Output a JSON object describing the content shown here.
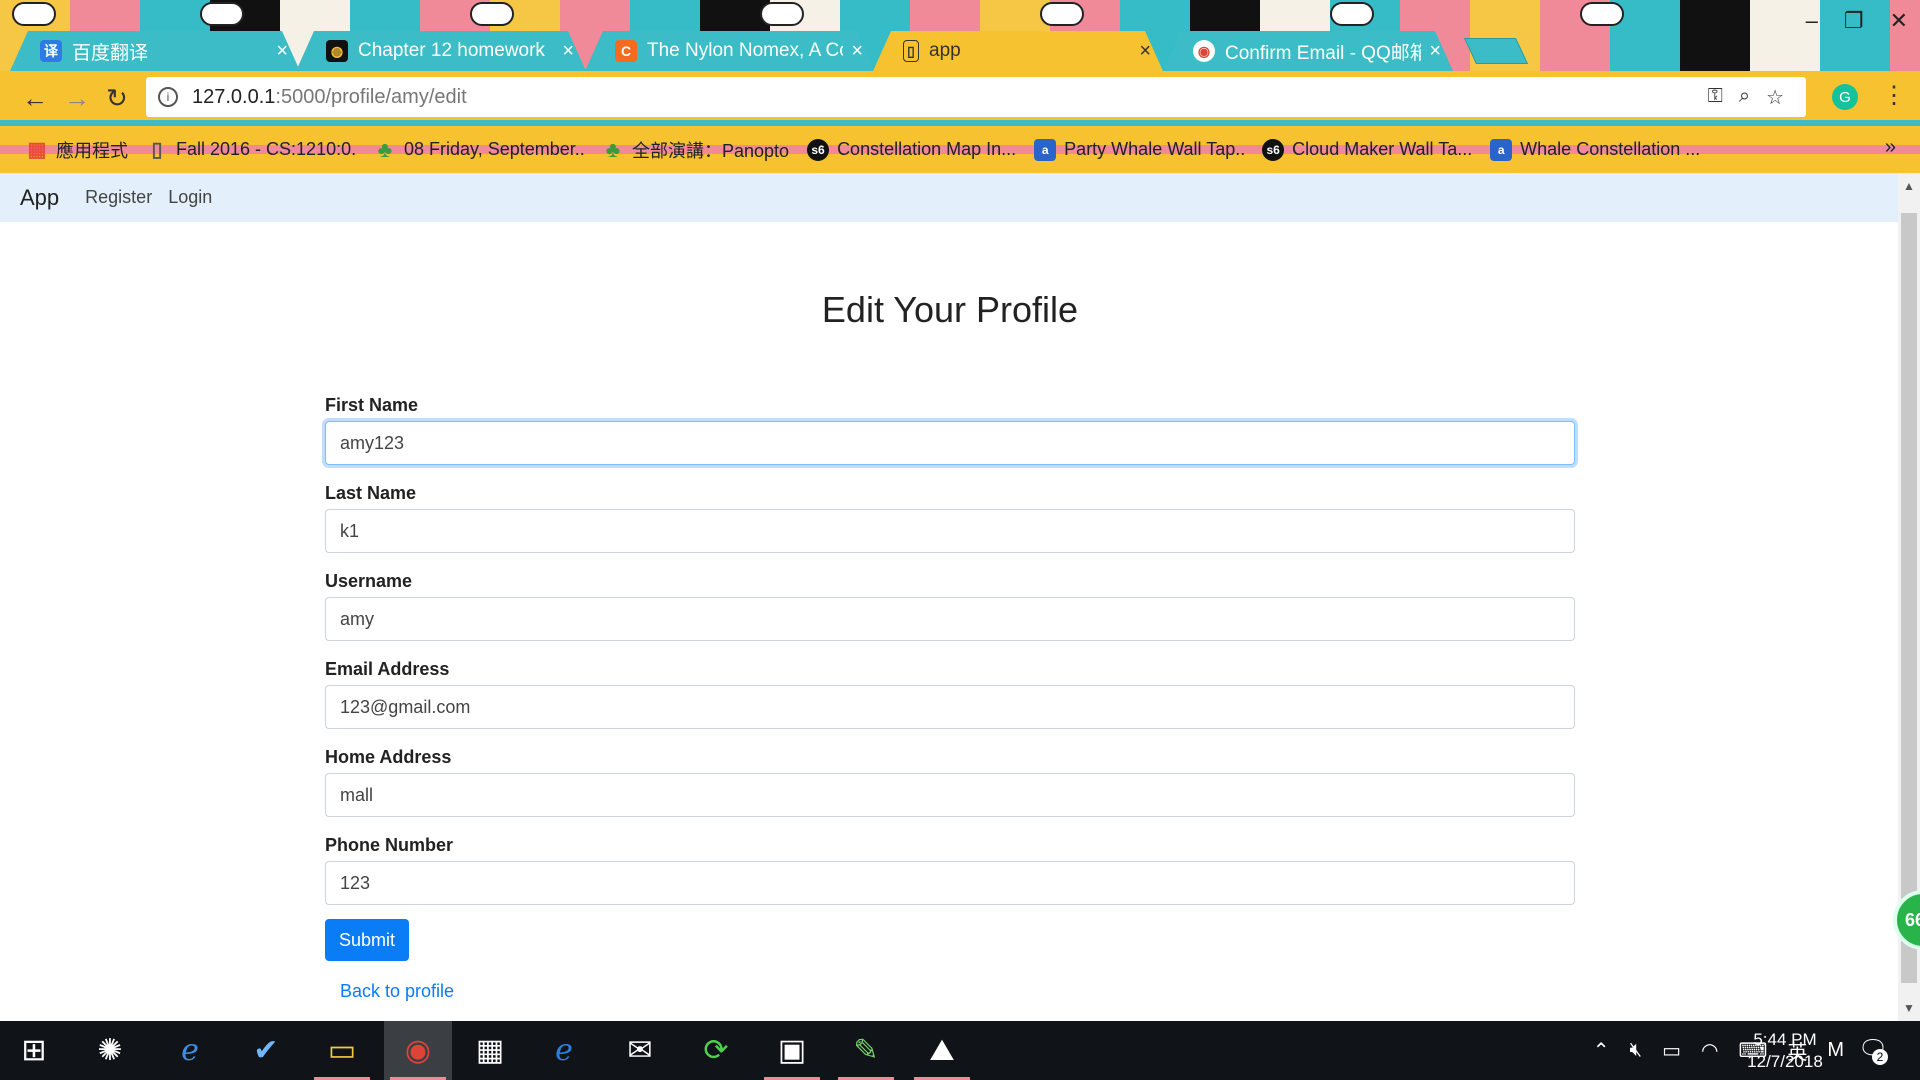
{
  "browser": {
    "tabs": [
      {
        "title": "百度翻译",
        "favicon_icon": "translate-icon",
        "favicon_glyph": "译",
        "favicon_color": "#2f7be5"
      },
      {
        "title": "Chapter 12 homework",
        "favicon_icon": "canvas-icon",
        "favicon_glyph": "◍",
        "favicon_color": "#111111"
      },
      {
        "title": "The Nylon Nomex, A Con",
        "favicon_icon": "c-logo-icon",
        "favicon_glyph": "C",
        "favicon_color": "#f26b21"
      },
      {
        "title": "app",
        "favicon_icon": "page-icon",
        "favicon_glyph": "▯",
        "favicon_color": "#f6c230",
        "active": true
      },
      {
        "title": "Confirm Email - QQ邮箱",
        "favicon_icon": "chrome-icon",
        "favicon_glyph": "◉",
        "favicon_color": "#db4437"
      }
    ],
    "tab_close_glyph": "×",
    "address": {
      "host": "127.0.0.1",
      "path": ":5000/profile/amy/edit"
    },
    "bookmarks": [
      {
        "label": "應用程式",
        "icon": "apps-grid-icon",
        "glyph": "▦",
        "color": "#e74c3c"
      },
      {
        "label": "Fall 2016 - CS:1210:0...",
        "icon": "document-icon",
        "glyph": "▯",
        "color": "#555555"
      },
      {
        "label": "08 Friday, September...",
        "icon": "panopto-icon",
        "glyph": "♣",
        "color": "#3a9b3a"
      },
      {
        "label": "全部演講：Panopto",
        "icon": "panopto-icon",
        "glyph": "♣",
        "color": "#3a9b3a"
      },
      {
        "label": "Constellation Map In...",
        "icon": "s6-icon",
        "glyph": "s6",
        "color": "#111111"
      },
      {
        "label": "Party Whale Wall Tap...",
        "icon": "amazon-icon",
        "glyph": "a",
        "color": "#2a63c9"
      },
      {
        "label": "Cloud Maker Wall Ta...",
        "icon": "s6-icon",
        "glyph": "s6",
        "color": "#111111"
      },
      {
        "label": "Whale Constellation ...",
        "icon": "amazon-icon",
        "glyph": "a",
        "color": "#2a63c9"
      }
    ],
    "bookmarks_more": "»",
    "extension_badge": "G"
  },
  "navbar": {
    "brand": "App",
    "links": [
      "Register",
      "Login"
    ]
  },
  "form": {
    "title": "Edit Your Profile",
    "fields": [
      {
        "label": "First Name",
        "value": "amy123"
      },
      {
        "label": "Last Name",
        "value": "k1"
      },
      {
        "label": "Username",
        "value": "amy"
      },
      {
        "label": "Email Address",
        "value": "123@gmail.com"
      },
      {
        "label": "Home Address",
        "value": "mall"
      },
      {
        "label": "Phone Number",
        "value": "123"
      }
    ],
    "submit_label": "Submit",
    "back_link": "Back to profile"
  },
  "floating_badge": "66",
  "taskbar": {
    "time": "5:44 PM",
    "date": "12/7/2018",
    "ime": "英",
    "ime_mode": "M",
    "notification_count": "2"
  },
  "colors": {
    "accent": "#0a7cf5",
    "navbar_bg": "#e3f0fb",
    "chrome_yellow": "#f6c230",
    "chrome_teal": "#3bbcc6"
  }
}
